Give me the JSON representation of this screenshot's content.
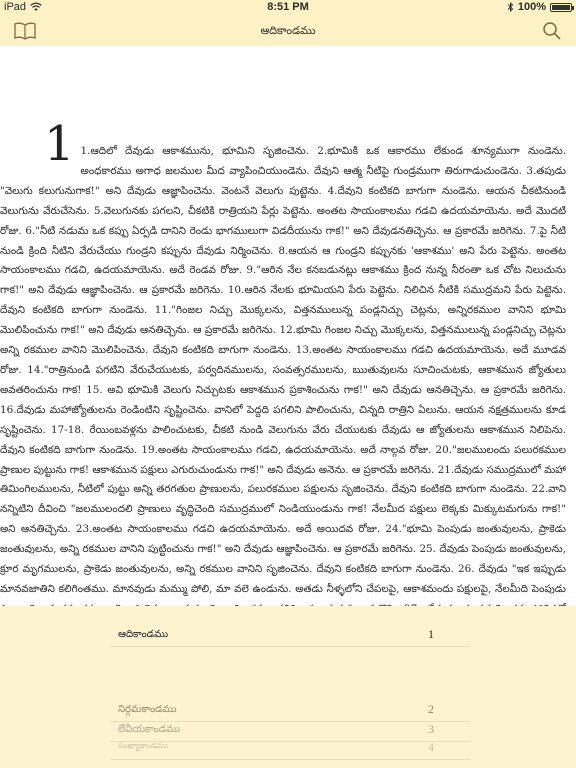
{
  "status": {
    "carrier": "iPad",
    "time": "8:51 PM",
    "battery": "100%"
  },
  "nav": {
    "title": "ఆదికాండము",
    "left_icon": "book-icon",
    "right_icon": "search-icon"
  },
  "reader": {
    "chapter_number": "1",
    "text": "1.ఆదిలో దేవుడు ఆకాశమును, భూమిని సృజించెను. 2.భూమికి ఒక ఆకారము లేకుండ శూన్యముగా నుండెను. అంధకారము అగాధ జలముల మీద వ్యాపించియుండెను. దేవుని ఆత్మ నీటిపై గుండ్రముగా తిరుగాడుచుండెను. 3.తపుడు \"వెలుగు కలుగునుగాక!\" అని దేవుడు ఆజ్ఞాపించెను. వెంటనే వెలుగు పుట్టెను. 4.దేవుని కంటికది బాగుగా నుండెను. ఆయన చీకటినుండి వెలుగును వేరుచేసెను. 5.వెలుగునకు పగలని, చీకటికి రాత్రియని పేర్లు పెట్టెను. అంతట సాయంకాలము గడచి ఉదయమాయెను. అదే మొదటి రోజు. 6.\"నీటి నడుమ ఒక కప్పు ఏర్పడి దానిని రెండు భాగములుగా విడదీయును గాక!\" అని దేవుడనతిచ్చెను. ఆ ప్రకారమే జరిగెను. 7.పై నీటి నుండి క్రింది నీటిని వేరుచేయు గుండ్రని కప్పును దేవుడు నిర్మించెను. 8.ఆయన ఆ గుండ్రని కప్పునకు 'ఆకాశము' అని పేరు పెట్టెను. అంతట సాయంకాలము గడచి, ఉదయమాయెను. అదే రెండవ రోజు. 9.\"ఆరిన నేల కనబడునట్లు ఆకాశము క్రింద నున్న నీరంతా ఒక చోట నిలుచును గాక!\" అని దేవుడు ఆజ్ఞాపించెను. ఆ ప్రకారమే జరిగెను. 10.ఆరిన నేలకు భూమియని పేరు పెట్టెను. నిలిచిన నీటికి సముద్రమని పేరు పెట్టెను. దేవుని కంటికది బాగుగా నుండెను. 11.\"గింజల నిచ్చు మొక్కలను, విత్తనములున్న పండ్లనిచ్చు చెట్లను, అన్నిరకముల వానిని భూమి మొలిపించును గాక!\" అని దేవుడు ఆనతిచ్చెను. ఆ ప్రకారమే జరిగెను. 12.భూమి గింజల నిచ్చు మొక్కలను, విత్తనములున్న పండ్లనిచ్చు చెట్లను అన్ని రకముల వానిని మొలిపించెను. దేవుని కంటికది బాగుగా నుండెను. 13.అంతట సాయంకాలము గడచి ఉదయమాయెను. అదే మూడవ రోజు. 14.\"రాత్రినుండి పగటిని వేరుచేయుటకు, పర్వదినములను, సంవత్సరములను, ఋతువులను సూచించుటకు, ఆకాశమున జ్యోతులు అవతరించును గాక! 15. అవి భూమికి వెలుగు నిచ్చుటకు ఆకాశమున ప్రకాశించును గాక!\" అని దేవుడు ఆనతిచ్చెను. ఆ ప్రకారమే జరిగెను. 16.దేవుడు మహాజ్యోతులను రెండింటిని సృష్టించెను. వానిలో పెద్దది పగలిని పాలించును, చిన్నది రాత్రిని ఏలును. ఆయన నక్షత్రములను కూడ సృష్టించెను. 17-18. రేయింబవళ్లను పాలించుటకు, చీకటి నుండి వెలుగును వేరు చేయుటకు దేవుడు ఆ జ్యోతులను ఆకాశమున నిలిపెను. దేవుని కంటికది బాగుగా నుండెను. 19.అంతట సాయంకాలము గడచి, ఉదయమాయెను. అదే నాల్గవ రోజు. 20.\"జలములందు పలురకముల ప్రాణుల పుట్టును గాక! ఆకాశమున పక్షులు ఎగురుచుండును గాక!\" అని దేవుడు అనెను. ఆ ప్రకారమే జరిగెను. 21.దేవుడు సముద్రములో మహా తిమింగిలములను, నీటిలో పుట్టు అన్ని తరగతుల ప్రాణులను, పలురకముల పక్షులను సృజించెను. దేవుని కంటికది బాగుగా నుండెను. 22.వాని నన్నిటిని దీవించి \"జలములందలి ప్రాణులు వృద్ధిచెంది సముద్రములో నిండియుండును గాక! నేలమీద పక్షులు లెక్కకు మిక్కుటమగును గాక!\" అని ఆనతిచ్చెను. 23.అంతట సాయంకాలము గడచి ఉదయమాయెను. అదే అయిదవ రోజు. 24.\"భూమి పెంపుడు జంతువులను, ప్రాకెడు జంతువులను, అన్ని రకముల వానిని పుట్టించును గాక!\" అని దేవుడు ఆజ్ఞాపించెను. ఆ ప్రకారమే జరిగెను. 25. దేవుడు పెంపుడు జంతువులను, క్రూర మృగములను, ప్రాకెడు జంతువులను, అన్ని రకముల వానిని సృజించెను. దేవుని కంటికది బాగుగా నుండెను. 26. దేవుడు \"ఇక ఇప్పుడు మానవజాతిని కలిగింతము. మానవుడు మమ్ము పోలి, మా వలె ఉండును. అతడు నీళ్ళలోని చేపలపై, ఆకాశమందు పక్షులపై, నేలమీది పెంపుడు ప్రాణులపై, క్రూరమృగము లపై, ప్రాకెడు జంతువులపై అధికారము కలిగి యుండును\" అనుకొని, 27. దేవుడు మానవుని తన పోలికలో సృజించెను. తన పోలికలో దేవుడు మానవుని సృజించెను. స్త్రీ, పురుషులుగా వారిని సృజించెను. 28.దేవుడు వారిని దీవించెను: ఫలించి,\"సంతానాభివృద్ధి పొంది, భూమందలి వందంతట వ్యాపించి, దానిని వశము చేసికొనుడు. నీళ్ళలోని చేపలను, ఆకాశములోని పక్షులను, నేల మీది జంతువులను పాలింపుడు. 29."
  },
  "toc": [
    {
      "name": "ఆదికాండము",
      "num": "1"
    },
    {
      "name": "నిర్గమకాండము",
      "num": "2"
    },
    {
      "name": "లేవీయకాండము",
      "num": "3"
    },
    {
      "name": "సంఖ్యాకాండము",
      "num": "4"
    }
  ],
  "colors": {
    "background": "#fdf4cf",
    "page": "#ffffff"
  }
}
